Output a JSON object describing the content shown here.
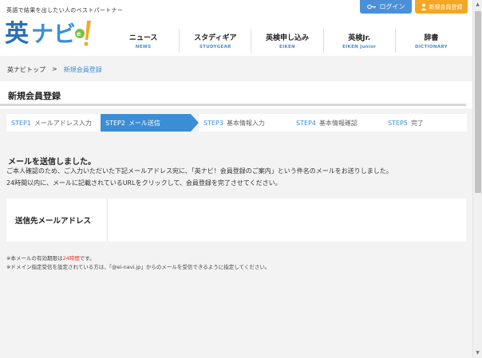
{
  "header": {
    "tagline": "英語で結果を出したい人のベストパートナー",
    "logo_text": "英ナビ!",
    "login_label": "ログイン",
    "register_label": "新規会員登録"
  },
  "nav": [
    {
      "label": "ニュース",
      "sub": "NEWS"
    },
    {
      "label": "スタディギア",
      "sub": "STUDYGEAR"
    },
    {
      "label": "英検申し込み",
      "sub": "EIKEN"
    },
    {
      "label": "英検Jr.",
      "sub": "EIKEN Junior"
    },
    {
      "label": "辞書",
      "sub": "DICTIONARY"
    }
  ],
  "breadcrumb": {
    "home": "英ナビトップ",
    "separator": ">",
    "current": "新規会員登録"
  },
  "page_title": "新規会員登録",
  "steps": [
    {
      "num": "STEP1",
      "label": "メールアドレス入力"
    },
    {
      "num": "STEP2",
      "label": "メール送信"
    },
    {
      "num": "STEP3",
      "label": "基本情報入力"
    },
    {
      "num": "STEP4",
      "label": "基本情報確認"
    },
    {
      "num": "STEP5",
      "label": "完了"
    }
  ],
  "active_step": 2,
  "message": {
    "heading": "メールを送信しました。",
    "line1": "ご本人確認のため、ご入力いただいた下記メールアドレス宛に、「英ナビ！会員登録のご案内」という件名のメールをお送りしました。",
    "line2": "24時間以内に、メールに記載されているURLをクリックして、会員登録を完了させてください。"
  },
  "email_table": {
    "label": "送信先メールアドレス",
    "value": ""
  },
  "notes": {
    "note1_prefix": "※本メールの有効期限は",
    "note1_highlight": "24時間",
    "note1_suffix": "です。",
    "note2": "※ドメイン指定受信を設定されている方は、「@ei-navi.jp」からのメールを受信できるように指定してください。"
  },
  "colors": {
    "accent": "#3b8ed6",
    "login": "#4a90d9",
    "register": "#f5a623",
    "highlight": "#e53935"
  }
}
